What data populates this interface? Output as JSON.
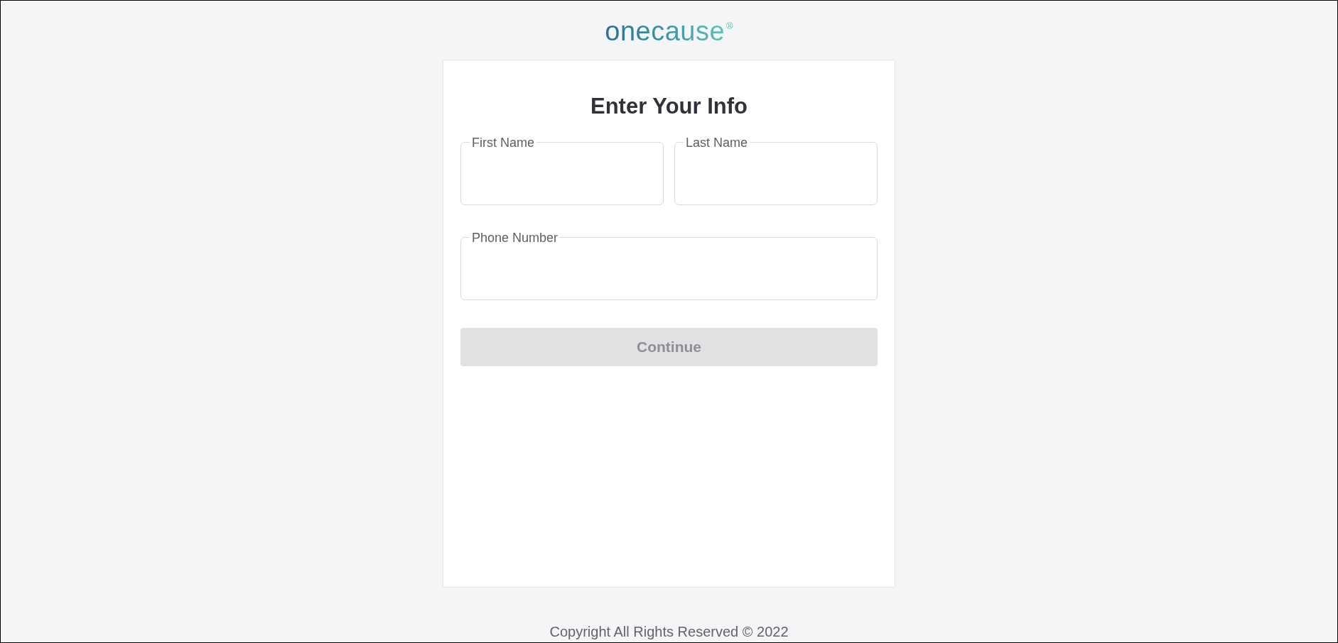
{
  "logo": {
    "text": "onecause",
    "mark": "®"
  },
  "card": {
    "title": "Enter Your Info",
    "field_rows": [
      [
        {
          "label": "First Name"
        },
        {
          "label": "Last Name"
        }
      ],
      [
        {
          "label": "Phone Number"
        }
      ]
    ],
    "button": {
      "label": "Continue",
      "disabled": true
    }
  },
  "footer": "Copyright All Rights Reserved © 2022"
}
